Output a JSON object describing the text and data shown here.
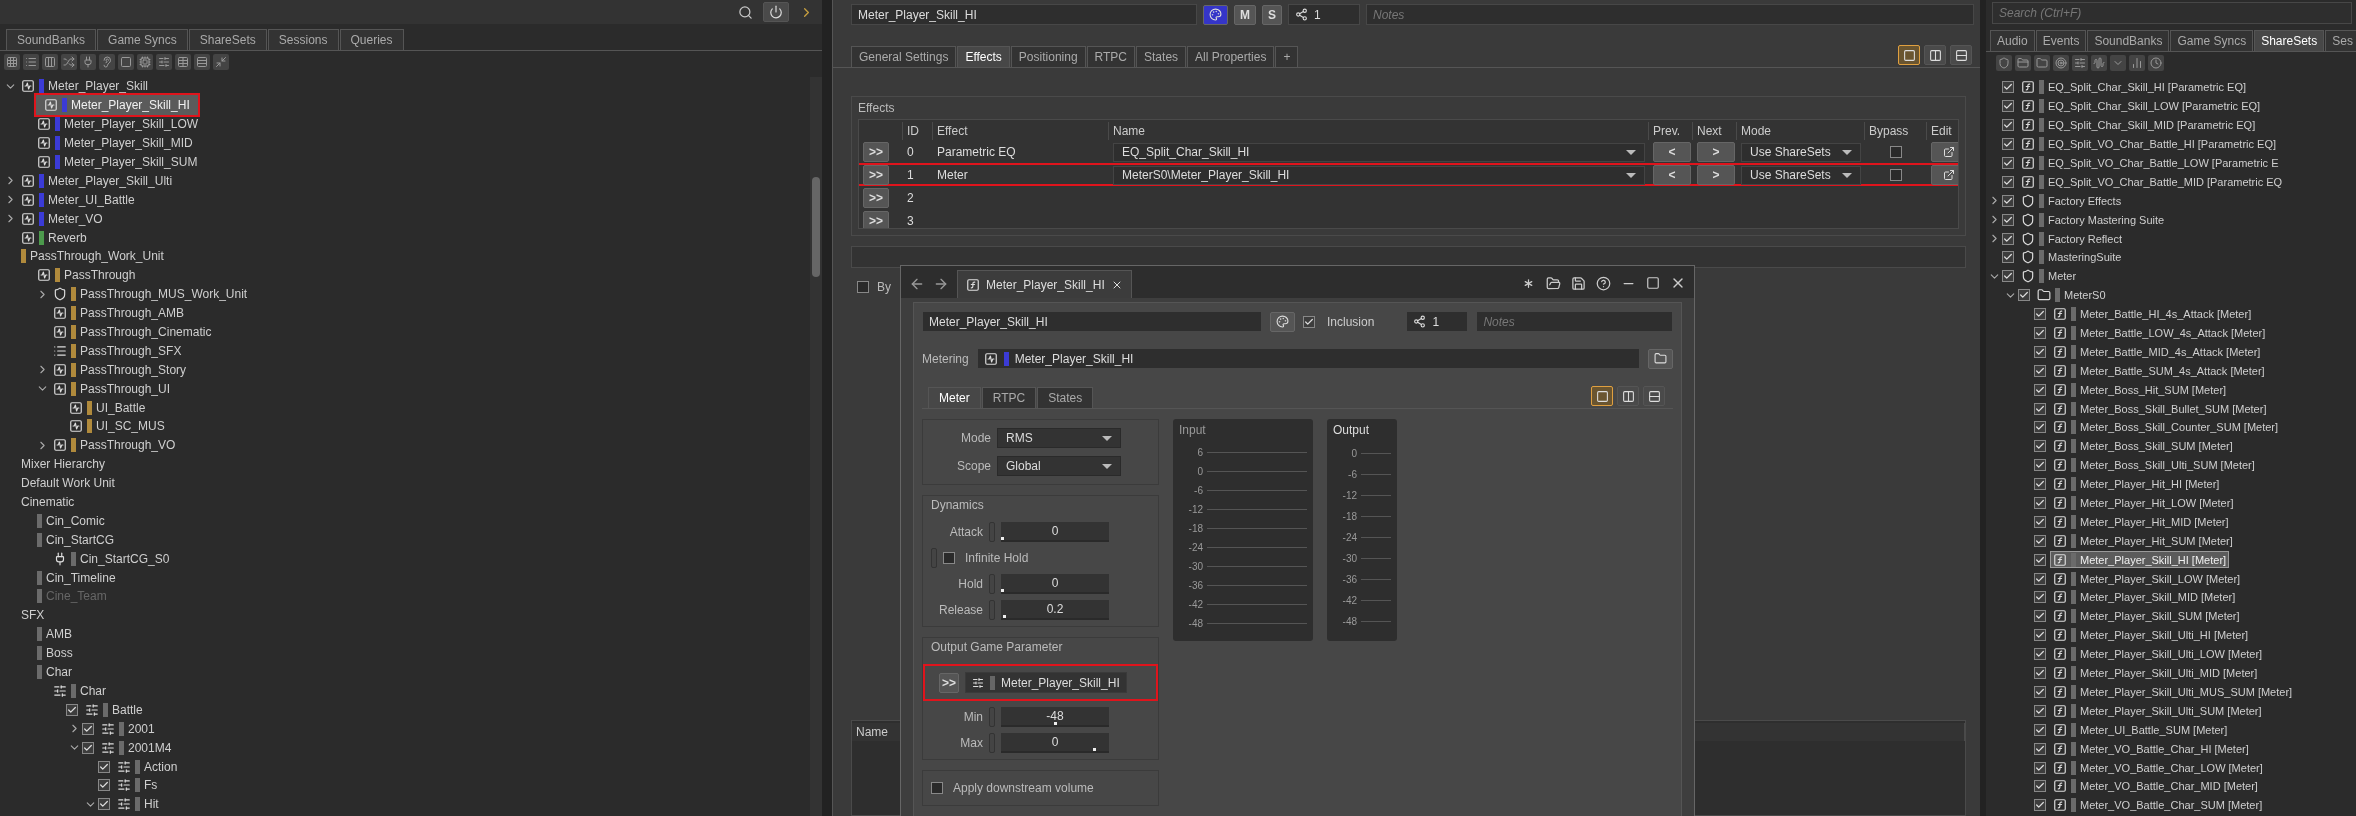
{
  "left_panel": {
    "tabs": [
      {
        "label": "SoundBanks",
        "selected": false
      },
      {
        "label": "Game Syncs",
        "selected": false
      },
      {
        "label": "ShareSets",
        "selected": false
      },
      {
        "label": "Sessions",
        "selected": false
      },
      {
        "label": "Queries",
        "selected": false
      }
    ],
    "tree": [
      {
        "label": "Meter_Player_Skill",
        "kind": "bus",
        "color": "#3b3bd6",
        "expanded": true,
        "selected": false,
        "marked": false,
        "disabled": false,
        "children": [
          {
            "label": "Meter_Player_Skill_HI",
            "kind": "bus",
            "color": "#3b3bd6",
            "selected": true,
            "marked": true,
            "disabled": false
          },
          {
            "label": "Meter_Player_Skill_LOW",
            "kind": "bus",
            "color": "#3b3bd6",
            "selected": false,
            "marked": false,
            "disabled": false
          },
          {
            "label": "Meter_Player_Skill_MID",
            "kind": "bus",
            "color": "#3b3bd6",
            "selected": false,
            "marked": false,
            "disabled": false
          },
          {
            "label": "Meter_Player_Skill_SUM",
            "kind": "bus",
            "color": "#3b3bd6",
            "selected": false,
            "marked": false,
            "disabled": false
          }
        ]
      },
      {
        "label": "Meter_Player_Skill_Ulti",
        "kind": "bus",
        "color": "#3b3bd6",
        "expanded": false,
        "selected": false,
        "marked": false,
        "disabled": false
      },
      {
        "label": "Meter_UI_Battle",
        "kind": "bus",
        "color": "#3b3bd6",
        "expanded": false,
        "selected": false,
        "marked": false,
        "disabled": false
      },
      {
        "label": "Meter_VO",
        "kind": "bus",
        "color": "#3b3bd6",
        "expanded": false,
        "selected": false,
        "marked": false,
        "disabled": false
      },
      {
        "label": "Reverb",
        "kind": "bus",
        "color": "#4c9a4c",
        "selected": false,
        "marked": false,
        "disabled": false
      },
      {
        "label": "PassThrough_Work_Unit",
        "color": "#b08a3c",
        "selected": false,
        "marked": false,
        "disabled": false,
        "children": [
          {
            "label": "PassThrough",
            "kind": "bus",
            "color": "#b08a3c",
            "selected": false,
            "marked": false,
            "disabled": false,
            "children": [
              {
                "label": "PassThrough_MUS_Work_Unit",
                "kind": "work-unit",
                "color": "#b08a3c",
                "expanded": false,
                "selected": false,
                "marked": false,
                "disabled": false
              },
              {
                "label": "PassThrough_AMB",
                "kind": "bus",
                "color": "#b08a3c",
                "selected": false,
                "marked": false,
                "disabled": false
              },
              {
                "label": "PassThrough_Cinematic",
                "kind": "bus",
                "color": "#b08a3c",
                "selected": false,
                "marked": false,
                "disabled": false
              },
              {
                "label": "PassThrough_SFX",
                "kind": "aux",
                "color": "#b08a3c",
                "selected": false,
                "marked": false,
                "disabled": false
              },
              {
                "label": "PassThrough_Story",
                "kind": "bus",
                "color": "#b08a3c",
                "expanded": false,
                "selected": false,
                "marked": false,
                "disabled": false
              },
              {
                "label": "PassThrough_UI",
                "kind": "bus",
                "color": "#b08a3c",
                "expanded": true,
                "selected": false,
                "marked": false,
                "disabled": false,
                "children": [
                  {
                    "label": "UI_Battle",
                    "kind": "bus",
                    "color": "#b08a3c",
                    "selected": false,
                    "marked": false,
                    "disabled": false
                  },
                  {
                    "label": "UI_SC_MUS",
                    "kind": "bus",
                    "color": "#b08a3c",
                    "selected": false,
                    "marked": false,
                    "disabled": false
                  }
                ]
              },
              {
                "label": "PassThrough_VO",
                "kind": "bus",
                "color": "#b08a3c",
                "expanded": false,
                "selected": false,
                "marked": false,
                "disabled": false
              }
            ]
          }
        ]
      },
      {
        "label": "Mixer Hierarchy",
        "selected": false,
        "marked": false,
        "disabled": false
      },
      {
        "label": "Default Work Unit",
        "selected": false,
        "marked": false,
        "disabled": false
      },
      {
        "label": "Cinematic",
        "selected": false,
        "marked": false,
        "disabled": false,
        "children": [
          {
            "label": "Cin_Comic",
            "color": "#6b6b6b",
            "selected": false,
            "marked": false,
            "disabled": false
          },
          {
            "label": "Cin_StartCG",
            "color": "#6b6b6b",
            "selected": false,
            "marked": false,
            "disabled": false,
            "children": [
              {
                "label": "Cin_StartCG_S0",
                "kind": "plugin",
                "color": "#6b6b6b",
                "selected": false,
                "marked": false,
                "disabled": false
              }
            ]
          },
          {
            "label": "Cin_Timeline",
            "color": "#6b6b6b",
            "selected": false,
            "marked": false,
            "disabled": false
          },
          {
            "label": "Cine_Team",
            "color": "#6b6b6b",
            "selected": false,
            "marked": false,
            "disabled": true
          }
        ]
      },
      {
        "label": "SFX",
        "selected": false,
        "marked": false,
        "disabled": false,
        "children": [
          {
            "label": "AMB",
            "color": "#6b6b6b",
            "selected": false,
            "marked": false,
            "disabled": false
          },
          {
            "label": "Boss",
            "color": "#6b6b6b",
            "selected": false,
            "marked": false,
            "disabled": false
          },
          {
            "label": "Char",
            "color": "#6b6b6b",
            "selected": false,
            "marked": false,
            "disabled": false,
            "children": [
              {
                "label": "Char",
                "kind": "mixer",
                "color": "#6b6b6b",
                "selected": false,
                "marked": false,
                "disabled": false,
                "children": [
                  {
                    "label": "Battle",
                    "kind": "mixer",
                    "color": "#6b6b6b",
                    "checked": true,
                    "selected": false,
                    "marked": false,
                    "disabled": false,
                    "children": [
                      {
                        "label": "2001",
                        "kind": "mixer",
                        "color": "#6b6b6b",
                        "checked": true,
                        "expanded": false,
                        "selected": false,
                        "marked": false,
                        "disabled": false
                      },
                      {
                        "label": "2001M4",
                        "kind": "mixer",
                        "color": "#6b6b6b",
                        "checked": true,
                        "expanded": true,
                        "selected": false,
                        "marked": false,
                        "disabled": false,
                        "children": [
                          {
                            "label": "Action",
                            "kind": "mixer",
                            "color": "#6b6b6b",
                            "checked": true,
                            "selected": false,
                            "marked": false,
                            "disabled": false
                          },
                          {
                            "label": "Fs",
                            "kind": "mixer",
                            "color": "#6b6b6b",
                            "checked": true,
                            "selected": false,
                            "marked": false,
                            "disabled": false
                          },
                          {
                            "label": "Hit",
                            "kind": "mixer",
                            "color": "#6b6b6b",
                            "checked": true,
                            "expanded": true,
                            "selected": false,
                            "marked": false,
                            "disabled": false
                          }
                        ]
                      }
                    ]
                  }
                ]
              }
            ]
          }
        ]
      }
    ]
  },
  "properties": {
    "name": "Meter_Player_Skill_HI",
    "mute": "M",
    "solo": "S",
    "share_count": "1",
    "notes_placeholder": "Notes",
    "tabs": [
      {
        "label": "General Settings",
        "selected": false
      },
      {
        "label": "Effects",
        "selected": true
      },
      {
        "label": "Positioning",
        "selected": false
      },
      {
        "label": "RTPC",
        "selected": false
      },
      {
        "label": "States",
        "selected": false
      },
      {
        "label": "All Properties",
        "selected": false
      },
      {
        "label": "+",
        "selected": false
      }
    ],
    "layout_buttons": [
      {
        "selected": true
      },
      {
        "selected": false
      },
      {
        "selected": false
      }
    ],
    "effects": {
      "title": "Effects",
      "columns": [
        "ID",
        "Effect",
        "Name",
        "Prev.",
        "Next",
        "Mode",
        "Bypass",
        "Edit"
      ],
      "rows": [
        {
          "button": ">>",
          "id": "0",
          "effect": "Parametric EQ",
          "name": "EQ_Split_Char_Skill_HI",
          "prev": "<",
          "next": ">",
          "mode": "Use ShareSets",
          "bypass": false,
          "highlighted": false
        },
        {
          "button": ">>",
          "id": "1",
          "effect": "Meter",
          "name": "MeterS0\\Meter_Player_Skill_HI",
          "prev": "<",
          "next": ">",
          "mode": "Use ShareSets",
          "bypass": false,
          "highlighted": true
        },
        {
          "button": ">>",
          "id": "2",
          "highlighted": false
        },
        {
          "button": ">>",
          "id": "3",
          "highlighted": false
        }
      ]
    },
    "bypass_label": "By",
    "bypass_checked": false,
    "list_columns": [
      "Name"
    ]
  },
  "effect_editor": {
    "tab_title": "Meter_Player_Skill_HI",
    "name": "Meter_Player_Skill_HI",
    "inclusion": {
      "label": "Inclusion",
      "checked": true
    },
    "share_count": "1",
    "notes_placeholder": "Notes",
    "metering": {
      "label": "Metering",
      "value": "Meter_Player_Skill_HI",
      "color": "#3b3bd6"
    },
    "tabs": [
      {
        "label": "Meter",
        "selected": true
      },
      {
        "label": "RTPC",
        "selected": false
      },
      {
        "label": "States",
        "selected": false
      }
    ],
    "layout_buttons": [
      {
        "selected": true
      },
      {
        "selected": false
      },
      {
        "selected": false
      }
    ],
    "mode": {
      "label": "Mode",
      "value": "RMS"
    },
    "scope": {
      "label": "Scope",
      "value": "Global"
    },
    "dynamics": {
      "title": "Dynamics",
      "attack": {
        "label": "Attack",
        "value": "0",
        "level": 0
      },
      "infinite_hold": {
        "label": "Infinite Hold",
        "checked": false
      },
      "hold": {
        "label": "Hold",
        "value": "0",
        "level": 0
      },
      "release": {
        "label": "Release",
        "value": "0.2",
        "level": 0.02
      }
    },
    "output_parameter": {
      "title": "Output Game Parameter",
      "button": ">>",
      "value": "Meter_Player_Skill_HI",
      "highlighted": true,
      "min": {
        "label": "Min",
        "value": "-48",
        "level": 0.5
      },
      "max": {
        "label": "Max",
        "value": "0",
        "level": 0.88
      }
    },
    "apply_downstream": {
      "label": "Apply downstream volume",
      "checked": false
    },
    "meters": [
      {
        "title": "Input",
        "scale": [
          "6",
          "0",
          "-6",
          "-12",
          "-18",
          "-24",
          "-30",
          "-36",
          "-42",
          "-48"
        ]
      },
      {
        "title": "Output",
        "scale": [
          "0",
          "-6",
          "-12",
          "-18",
          "-24",
          "-30",
          "-36",
          "-42",
          "-48"
        ]
      }
    ]
  },
  "sharesets_panel": {
    "search_placeholder": "Search (Ctrl+F)",
    "tabs": [
      {
        "label": "Audio",
        "selected": false
      },
      {
        "label": "Events",
        "selected": false
      },
      {
        "label": "SoundBanks",
        "selected": false
      },
      {
        "label": "Game Syncs",
        "selected": false
      },
      {
        "label": "ShareSets",
        "selected": true
      },
      {
        "label": "Ses",
        "selected": false
      }
    ],
    "tree": [
      {
        "label": "EQ_Split_Char_Skill_HI [Parametric EQ]",
        "kind": "effect",
        "color": "#6b6b6b",
        "checked": true,
        "selected": false
      },
      {
        "label": "EQ_Split_Char_Skill_LOW [Parametric EQ]",
        "kind": "effect",
        "color": "#6b6b6b",
        "checked": true,
        "selected": false
      },
      {
        "label": "EQ_Split_Char_Skill_MID [Parametric EQ]",
        "kind": "effect",
        "color": "#6b6b6b",
        "checked": true,
        "selected": false
      },
      {
        "label": "EQ_Split_VO_Char_Battle_HI [Parametric EQ]",
        "kind": "effect",
        "color": "#6b6b6b",
        "checked": true,
        "selected": false
      },
      {
        "label": "EQ_Split_VO_Char_Battle_LOW [Parametric E",
        "kind": "effect",
        "color": "#6b6b6b",
        "checked": true,
        "selected": false
      },
      {
        "label": "EQ_Split_VO_Char_Battle_MID [Parametric EQ",
        "kind": "effect",
        "color": "#6b6b6b",
        "checked": true,
        "selected": false
      },
      {
        "label": "Factory Effects",
        "kind": "work-unit",
        "color": "#6b6b6b",
        "checked": true,
        "expanded": false,
        "selected": false
      },
      {
        "label": "Factory Mastering Suite",
        "kind": "work-unit",
        "color": "#6b6b6b",
        "checked": true,
        "expanded": false,
        "selected": false
      },
      {
        "label": "Factory Reflect",
        "kind": "work-unit",
        "color": "#6b6b6b",
        "checked": true,
        "expanded": false,
        "selected": false
      },
      {
        "label": "MasteringSuite",
        "kind": "work-unit",
        "color": "#6b6b6b",
        "checked": true,
        "selected": false
      },
      {
        "label": "Meter",
        "kind": "work-unit",
        "color": "#6b6b6b",
        "checked": true,
        "expanded": true,
        "selected": false,
        "children": [
          {
            "label": "MeterS0",
            "kind": "folder",
            "color": "#6b6b6b",
            "checked": true,
            "expanded": true,
            "selected": false,
            "children": [
              {
                "label": "Meter_Battle_HI_4s_Attack [Meter]",
                "kind": "effect",
                "color": "#6b6b6b",
                "checked": true,
                "selected": false
              },
              {
                "label": "Meter_Battle_LOW_4s_Attack [Meter]",
                "kind": "effect",
                "color": "#6b6b6b",
                "checked": true,
                "selected": false
              },
              {
                "label": "Meter_Battle_MID_4s_Attack [Meter]",
                "kind": "effect",
                "color": "#6b6b6b",
                "checked": true,
                "selected": false
              },
              {
                "label": "Meter_Battle_SUM_4s_Attack [Meter]",
                "kind": "effect",
                "color": "#6b6b6b",
                "checked": true,
                "selected": false
              },
              {
                "label": "Meter_Boss_Hit_SUM [Meter]",
                "kind": "effect",
                "color": "#6b6b6b",
                "checked": true,
                "selected": false
              },
              {
                "label": "Meter_Boss_Skill_Bullet_SUM [Meter]",
                "kind": "effect",
                "color": "#6b6b6b",
                "checked": true,
                "selected": false
              },
              {
                "label": "Meter_Boss_Skill_Counter_SUM [Meter]",
                "kind": "effect",
                "color": "#6b6b6b",
                "checked": true,
                "selected": false
              },
              {
                "label": "Meter_Boss_Skill_SUM [Meter]",
                "kind": "effect",
                "color": "#6b6b6b",
                "checked": true,
                "selected": false
              },
              {
                "label": "Meter_Boss_Skill_Ulti_SUM [Meter]",
                "kind": "effect",
                "color": "#6b6b6b",
                "checked": true,
                "selected": false
              },
              {
                "label": "Meter_Player_Hit_HI [Meter]",
                "kind": "effect",
                "color": "#6b6b6b",
                "checked": true,
                "selected": false
              },
              {
                "label": "Meter_Player_Hit_LOW [Meter]",
                "kind": "effect",
                "color": "#6b6b6b",
                "checked": true,
                "selected": false
              },
              {
                "label": "Meter_Player_Hit_MID [Meter]",
                "kind": "effect",
                "color": "#6b6b6b",
                "checked": true,
                "selected": false
              },
              {
                "label": "Meter_Player_Hit_SUM [Meter]",
                "kind": "effect",
                "color": "#6b6b6b",
                "checked": true,
                "selected": false
              },
              {
                "label": "Meter_Player_Skill_HI [Meter]",
                "kind": "effect",
                "color": "#6b6b6b",
                "checked": true,
                "selected": true
              },
              {
                "label": "Meter_Player_Skill_LOW [Meter]",
                "kind": "effect",
                "color": "#6b6b6b",
                "checked": true,
                "selected": false
              },
              {
                "label": "Meter_Player_Skill_MID [Meter]",
                "kind": "effect",
                "color": "#6b6b6b",
                "checked": true,
                "selected": false
              },
              {
                "label": "Meter_Player_Skill_SUM [Meter]",
                "kind": "effect",
                "color": "#6b6b6b",
                "checked": true,
                "selected": false
              },
              {
                "label": "Meter_Player_Skill_Ulti_HI [Meter]",
                "kind": "effect",
                "color": "#6b6b6b",
                "checked": true,
                "selected": false
              },
              {
                "label": "Meter_Player_Skill_Ulti_LOW [Meter]",
                "kind": "effect",
                "color": "#6b6b6b",
                "checked": true,
                "selected": false
              },
              {
                "label": "Meter_Player_Skill_Ulti_MID [Meter]",
                "kind": "effect",
                "color": "#6b6b6b",
                "checked": true,
                "selected": false
              },
              {
                "label": "Meter_Player_Skill_Ulti_MUS_SUM [Meter]",
                "kind": "effect",
                "color": "#6b6b6b",
                "checked": true,
                "selected": false
              },
              {
                "label": "Meter_Player_Skill_Ulti_SUM [Meter]",
                "kind": "effect",
                "color": "#6b6b6b",
                "checked": true,
                "selected": false
              },
              {
                "label": "Meter_UI_Battle_SUM [Meter]",
                "kind": "effect",
                "color": "#6b6b6b",
                "checked": true,
                "selected": false
              },
              {
                "label": "Meter_VO_Battle_Char_HI [Meter]",
                "kind": "effect",
                "color": "#6b6b6b",
                "checked": true,
                "selected": false
              },
              {
                "label": "Meter_VO_Battle_Char_LOW [Meter]",
                "kind": "effect",
                "color": "#6b6b6b",
                "checked": true,
                "selected": false
              },
              {
                "label": "Meter_VO_Battle_Char_MID [Meter]",
                "kind": "effect",
                "color": "#6b6b6b",
                "checked": true,
                "selected": false
              },
              {
                "label": "Meter_VO_Battle_Char_SUM [Meter]",
                "kind": "effect",
                "color": "#6b6b6b",
                "checked": true,
                "selected": false
              }
            ]
          }
        ]
      }
    ]
  }
}
